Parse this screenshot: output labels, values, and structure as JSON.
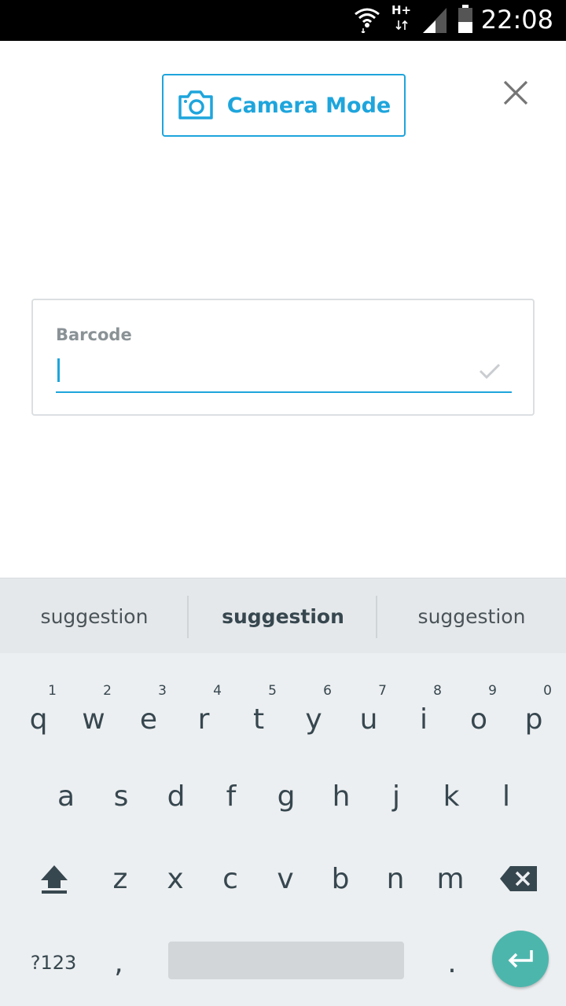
{
  "status_bar": {
    "network_type": "H+",
    "time": "22:08"
  },
  "header": {
    "camera_mode_label": "Camera Mode",
    "icons": {
      "camera": "camera-icon",
      "close": "close-icon"
    }
  },
  "barcode": {
    "label": "Barcode",
    "value": ""
  },
  "keyboard": {
    "suggestions": [
      "suggestion",
      "suggestion",
      "suggestion"
    ],
    "row1": [
      {
        "ch": "q",
        "hint": "1"
      },
      {
        "ch": "w",
        "hint": "2"
      },
      {
        "ch": "e",
        "hint": "3"
      },
      {
        "ch": "r",
        "hint": "4"
      },
      {
        "ch": "t",
        "hint": "5"
      },
      {
        "ch": "y",
        "hint": "6"
      },
      {
        "ch": "u",
        "hint": "7"
      },
      {
        "ch": "i",
        "hint": "8"
      },
      {
        "ch": "o",
        "hint": "9"
      },
      {
        "ch": "p",
        "hint": "0"
      }
    ],
    "row2": [
      "a",
      "s",
      "d",
      "f",
      "g",
      "h",
      "j",
      "k",
      "l"
    ],
    "row3": [
      "z",
      "x",
      "c",
      "v",
      "b",
      "n",
      "m"
    ],
    "symbols_label": "?123",
    "comma": ",",
    "period": ".",
    "accent_color": "#4db6ac"
  },
  "colors": {
    "primary": "#1ea5dc",
    "label_gray": "#8a9296",
    "key_text": "#37474f"
  }
}
